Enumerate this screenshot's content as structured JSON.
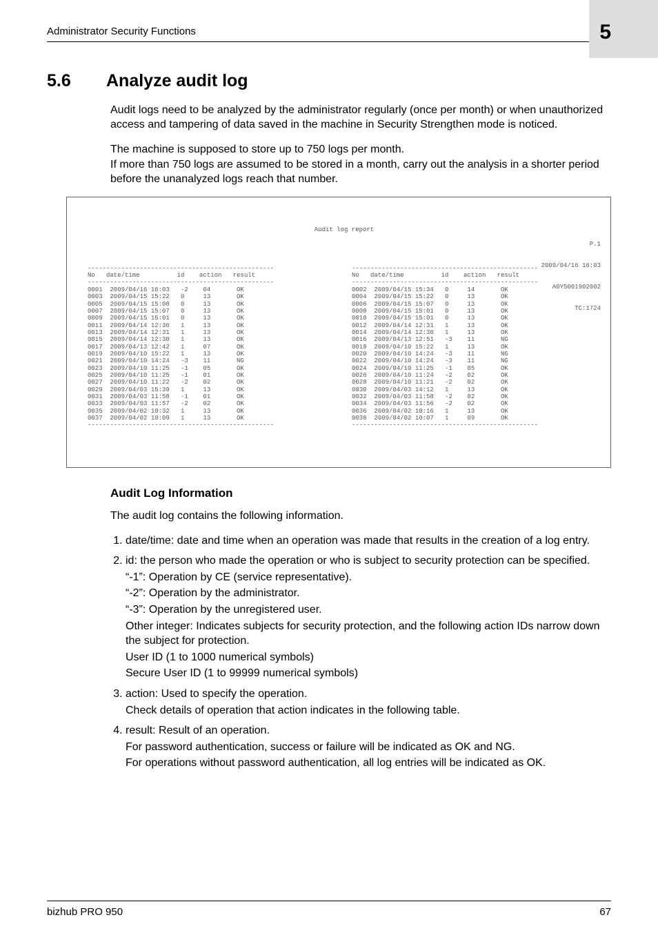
{
  "header": {
    "title": "Administrator Security Functions",
    "chapter": "5"
  },
  "section": {
    "number": "5.6",
    "title": "Analyze audit log"
  },
  "intro_p1": "Audit logs need to be analyzed by the administrator regularly (once per month) or when unauthorized access and tampering of data saved in the machine in Security Strengthen mode is noticed.",
  "intro_p2": "The machine is supposed to store up to 750 logs per month.\nIf more than 750 logs are assumed to be stored in a month, carry out the analysis in a shorter period before the unanalyzed logs reach that number.",
  "report": {
    "title": "Audit log report",
    "right": {
      "page": "P.1",
      "datetime": "2009/04/16 16:03",
      "serial": "A0Y5001902002",
      "tc": "TC:1724"
    },
    "headers": "No   date/time          id    action   result",
    "left_rows": [
      "0001  2009/04/16 16:03   -2    04       OK",
      "0003  2009/04/15 15:22   0     13       OK",
      "0005  2009/04/15 15:08   0     13       OK",
      "0007  2009/04/15 15:07   0     13       OK",
      "0009  2009/04/15 15:01   0     13       OK",
      "0011  2009/04/14 12:36   1     13       OK",
      "0013  2009/04/14 12:31   1     13       OK",
      "0015  2009/04/14 12:30   1     13       OK",
      "0017  2009/04/13 12:42   1     07       OK",
      "0019  2009/04/10 15:22   1     13       OK",
      "0021  2009/04/10 14:24   -3    11       NG",
      "0023  2009/04/10 11:25   -1    05       OK",
      "0025  2009/04/10 11:25   -1    01       OK",
      "0027  2009/04/10 11:22   -2    02       OK",
      "0029  2009/04/03 15:39   1     13       OK",
      "0031  2009/04/03 11:58   -1    01       OK",
      "0033  2009/04/03 11:57   -2    02       OK",
      "0035  2009/04/02 10:32   1     13       OK",
      "0037  2009/04/02 10:09   1     13       OK"
    ],
    "right_rows": [
      "0002  2009/04/15 15:34   0     14       OK",
      "0004  2009/04/15 15:22   0     13       OK",
      "0006  2009/04/15 15:07   0     13       OK",
      "0008  2009/04/15 15:01   0     13       OK",
      "0010  2009/04/15 15:01   0     13       OK",
      "0012  2009/04/14 12:31   1     13       OK",
      "0014  2009/04/14 12:30   1     13       OK",
      "0016  2009/04/13 12:51   -3    11       NG",
      "0018  2009/04/10 15:22   1     13       OK",
      "0020  2009/04/10 14:24   -3    11       NG",
      "0022  2009/04/10 14:24   -3    11       NG",
      "0024  2009/04/10 11:25   -1    05       OK",
      "0026  2009/04/10 11:24   -2    02       OK",
      "0028  2009/04/10 11:21   -2    02       OK",
      "0030  2009/04/03 14:12   1     13       OK",
      "0032  2009/04/03 11:58   -2    02       OK",
      "0034  2009/04/03 11:56   -2    02       OK",
      "0036  2009/04/02 10:16   1     13       OK",
      "0038  2009/04/02 10:07   1     09       OK"
    ]
  },
  "subhead": "Audit Log Information",
  "sub_intro": "The audit log contains the following information.",
  "items": {
    "i1": "date/time: date and time when an operation was made that results in the creation of a log entry.",
    "i2": "id: the person who made the operation or who is subject to security protection can be specified.",
    "i2_lines": {
      "a": "“-1”: Operation by CE (service representative).",
      "b": "“-2”: Operation by the administrator.",
      "c": "“-3”: Operation by the unregistered user.",
      "d": "Other integer: Indicates subjects for security protection, and the following action IDs narrow down the subject for protection.",
      "e": "User ID (1 to 1000 numerical symbols)",
      "f": "Secure User ID (1 to 99999 numerical symbols)"
    },
    "i3": "action: Used to specify the operation.",
    "i3_b": "Check details of operation that action indicates in the following table.",
    "i4": "result: Result of an operation.",
    "i4_b": "For password authentication, success or failure will be indicated as OK and NG.",
    "i4_c": "For operations without password authentication, all log entries will be indicated as OK."
  },
  "footer": {
    "product": "bizhub PRO 950",
    "page": "67"
  }
}
